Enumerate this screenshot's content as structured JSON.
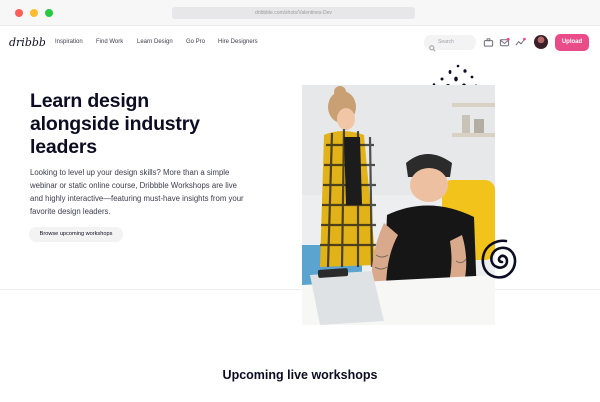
{
  "browser": {
    "url": "dribbble.com/shots/Valentines-Dev"
  },
  "nav": {
    "logo_text": "dribbble",
    "links": [
      "Inspiration",
      "Find Work",
      "Learn Design",
      "Go Pro",
      "Hire Designers"
    ],
    "search_placeholder": "Search",
    "upload_label": "Upload"
  },
  "hero": {
    "title": "Learn design alongside industry leaders",
    "body": "Looking to level up your design skills? More than a simple webinar or static online course, Dribbble Workshops are live and highly interactive—featuring must-have insights from your favorite design leaders.",
    "cta_label": "Browse upcoming workshops"
  },
  "section": {
    "title": "Upcoming live workshops"
  },
  "colors": {
    "brand_pink": "#ea4c89",
    "text_dark": "#0d0c22",
    "text_body": "#3d3d4e"
  }
}
